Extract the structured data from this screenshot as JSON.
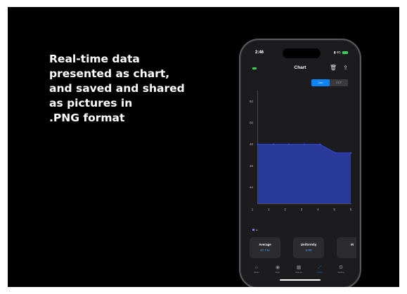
{
  "headline": [
    "Real-time data",
    "presented as chart,",
    "and saved and shared",
    "as pictures in",
    ".PNG format"
  ],
  "status_bar": {
    "time": "2:46",
    "network": "4G"
  },
  "nav": {
    "title": "Chart",
    "delete_icon": "trash-icon",
    "share_icon": "share-icon"
  },
  "segmented": {
    "lux_label": "Lux",
    "cct_label": "CCT",
    "selected": "Lux"
  },
  "chart_data": {
    "type": "area",
    "x_tick_labels": [
      "1",
      "1",
      "2",
      "3",
      "4",
      "5",
      "5"
    ],
    "y_tick_labels": [
      "52",
      "50",
      "48",
      "46",
      "44"
    ],
    "values": [
      48,
      48,
      48,
      48,
      48,
      47.2,
      47.2
    ],
    "ylim": [
      42.5,
      53
    ],
    "series_color": "#2a3a9a",
    "line_color": "#2e44d8",
    "legend": "lx"
  },
  "cards": [
    {
      "label": "Average",
      "value": "47.71x"
    },
    {
      "label": "Uniformity",
      "value": "0.93"
    },
    {
      "label": "M",
      "value": ""
    }
  ],
  "tabs": [
    {
      "icon": "sun-icon",
      "label": "Meter"
    },
    {
      "icon": "bulb-icon",
      "label": "Bulb"
    },
    {
      "icon": "grid-icon",
      "label": "Spaces"
    },
    {
      "icon": "chart-icon",
      "label": "Chart",
      "active": true
    },
    {
      "icon": "gear-icon",
      "label": "Setting"
    }
  ],
  "colors": {
    "accent": "#0a84ff",
    "battery": "#37d15a",
    "background": "#000000"
  }
}
